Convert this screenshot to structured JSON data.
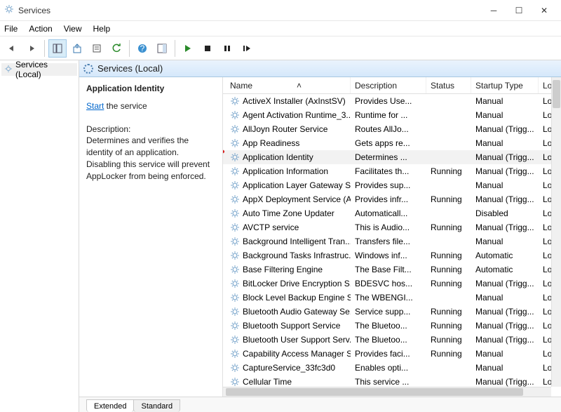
{
  "window": {
    "title": "Services"
  },
  "menubar": {
    "items": [
      "File",
      "Action",
      "View",
      "Help"
    ]
  },
  "toolbar_icons": [
    "back",
    "forward",
    "show-hide-tree",
    "export",
    "properties",
    "refresh",
    "help",
    "show-hide-action",
    "play",
    "stop",
    "pause",
    "restart"
  ],
  "tree": {
    "item": "Services (Local)"
  },
  "content_header": "Services (Local)",
  "detail": {
    "heading": "Application Identity",
    "start_link": "Start",
    "start_rest": " the service",
    "description_label": "Description:",
    "description_text": "Determines and verifies the identity of an application. Disabling this service will prevent AppLocker from being enforced."
  },
  "columns": {
    "name": "Name",
    "desc": "Description",
    "status": "Status",
    "startup": "Startup Type",
    "logon": "Log"
  },
  "sorted_col": "name",
  "rows": [
    {
      "name": "ActiveX Installer (AxInstSV)",
      "desc": "Provides Use...",
      "status": "",
      "startup": "Manual",
      "logon": "Loc"
    },
    {
      "name": "Agent Activation Runtime_3...",
      "desc": "Runtime for ...",
      "status": "",
      "startup": "Manual",
      "logon": "Loc"
    },
    {
      "name": "AllJoyn Router Service",
      "desc": "Routes AllJo...",
      "status": "",
      "startup": "Manual (Trigg...",
      "logon": "Loc"
    },
    {
      "name": "App Readiness",
      "desc": "Gets apps re...",
      "status": "",
      "startup": "Manual",
      "logon": "Loc"
    },
    {
      "name": "Application Identity",
      "desc": "Determines ...",
      "status": "",
      "startup": "Manual (Trigg...",
      "logon": "Loc",
      "selected": true
    },
    {
      "name": "Application Information",
      "desc": "Facilitates th...",
      "status": "Running",
      "startup": "Manual (Trigg...",
      "logon": "Loc"
    },
    {
      "name": "Application Layer Gateway S...",
      "desc": "Provides sup...",
      "status": "",
      "startup": "Manual",
      "logon": "Loc"
    },
    {
      "name": "AppX Deployment Service (A...",
      "desc": "Provides infr...",
      "status": "Running",
      "startup": "Manual (Trigg...",
      "logon": "Loc"
    },
    {
      "name": "Auto Time Zone Updater",
      "desc": "Automaticall...",
      "status": "",
      "startup": "Disabled",
      "logon": "Loc"
    },
    {
      "name": "AVCTP service",
      "desc": "This is Audio...",
      "status": "Running",
      "startup": "Manual (Trigg...",
      "logon": "Loc"
    },
    {
      "name": "Background Intelligent Tran...",
      "desc": "Transfers file...",
      "status": "",
      "startup": "Manual",
      "logon": "Loc"
    },
    {
      "name": "Background Tasks Infrastruc...",
      "desc": "Windows inf...",
      "status": "Running",
      "startup": "Automatic",
      "logon": "Loc"
    },
    {
      "name": "Base Filtering Engine",
      "desc": "The Base Filt...",
      "status": "Running",
      "startup": "Automatic",
      "logon": "Loc"
    },
    {
      "name": "BitLocker Drive Encryption S...",
      "desc": "BDESVC hos...",
      "status": "Running",
      "startup": "Manual (Trigg...",
      "logon": "Loc"
    },
    {
      "name": "Block Level Backup Engine S...",
      "desc": "The WBENGI...",
      "status": "",
      "startup": "Manual",
      "logon": "Loc"
    },
    {
      "name": "Bluetooth Audio Gateway Se...",
      "desc": "Service supp...",
      "status": "Running",
      "startup": "Manual (Trigg...",
      "logon": "Loc"
    },
    {
      "name": "Bluetooth Support Service",
      "desc": "The Bluetoo...",
      "status": "Running",
      "startup": "Manual (Trigg...",
      "logon": "Loc"
    },
    {
      "name": "Bluetooth User Support Serv...",
      "desc": "The Bluetoo...",
      "status": "Running",
      "startup": "Manual (Trigg...",
      "logon": "Loc"
    },
    {
      "name": "Capability Access Manager S...",
      "desc": "Provides faci...",
      "status": "Running",
      "startup": "Manual",
      "logon": "Loc"
    },
    {
      "name": "CaptureService_33fc3d0",
      "desc": "Enables opti...",
      "status": "",
      "startup": "Manual",
      "logon": "Loc"
    },
    {
      "name": "Cellular Time",
      "desc": "This service ...",
      "status": "",
      "startup": "Manual (Trigg...",
      "logon": "Loc"
    }
  ],
  "tabs": {
    "extended": "Extended",
    "standard": "Standard"
  }
}
